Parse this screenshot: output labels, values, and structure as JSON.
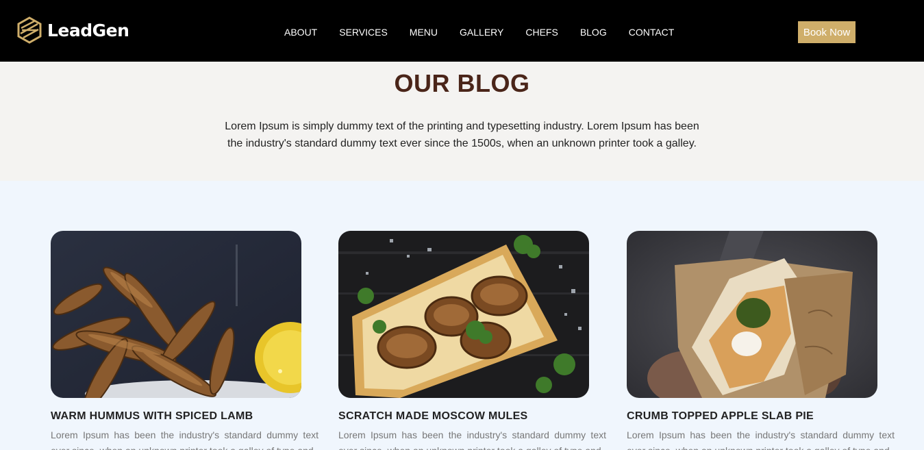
{
  "brand": {
    "name": "LeadGen",
    "accent": "#cfae6a"
  },
  "nav": [
    "ABOUT",
    "SERVICES",
    "MENU",
    "GALLERY",
    "CHEFS",
    "BLOG",
    "CONTACT"
  ],
  "cta": {
    "label": "Book Now"
  },
  "intro": {
    "title": "OUR BLOG",
    "text": "Lorem Ipsum is simply dummy text of the printing and typesetting industry. Lorem Ipsum has been the industry's standard dummy text ever since the 1500s, when an unknown printer took a galley."
  },
  "posts": [
    {
      "title": "WARM HUMMUS WITH SPICED LAMB",
      "excerpt": "Lorem Ipsum has been the industry's standard dummy text ever since, when an unknown printer took a galley of type and"
    },
    {
      "title": "SCRATCH MADE MOSCOW MULES",
      "excerpt": "Lorem Ipsum has been the industry's standard dummy text ever since, when an unknown printer took a galley of type and"
    },
    {
      "title": "CRUMB TOPPED APPLE SLAB PIE",
      "excerpt": "Lorem Ipsum has been the industry's standard dummy text ever since, when an unknown printer took a galley of type and"
    }
  ]
}
